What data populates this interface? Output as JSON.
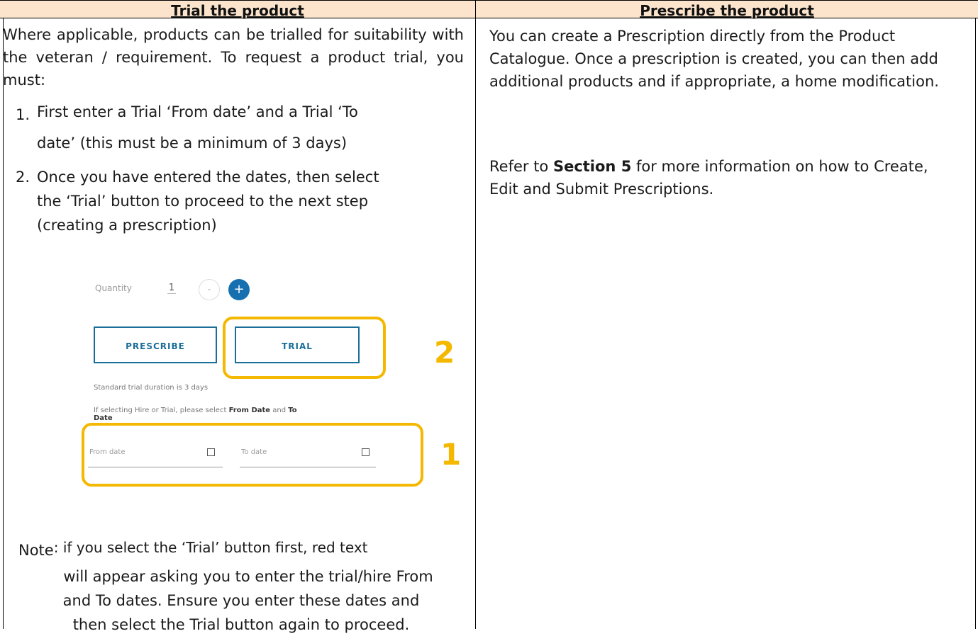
{
  "headers": {
    "left": "Trial the product",
    "right": "Prescribe the product"
  },
  "left": {
    "intro": "Where applicable, products can be trialled for suitability with the veteran / requirement. To request a product trial, you must:",
    "steps": [
      {
        "num": "1.",
        "line1": "First enter a Trial ‘From date’ and a Trial ‘To",
        "line2": "date’  (this must be a minimum of 3 days)"
      },
      {
        "num": "2.",
        "line1": "Once you have entered the dates, then select",
        "line2": "the ‘Trial’ button to proceed to the next step",
        "line3": "(creating a prescription)"
      }
    ],
    "screenshot": {
      "quantity_label": "Quantity",
      "quantity_value": "1",
      "minus": "-",
      "plus": "+",
      "prescribe_button": "PRESCRIBE",
      "trial_button": "TRIAL",
      "duration_text": "Standard trial duration is 3 days",
      "instruction_prefix": "If selecting Hire or Trial, please select ",
      "instruction_from": "From Date",
      "instruction_and": " and ",
      "instruction_to": "To",
      "instruction_to2": "Date",
      "from_placeholder": "From date",
      "to_placeholder": "To date",
      "callout_1": "1",
      "callout_2": "2",
      "highlight_color": "#F5B800",
      "button_color": "#1a6e9a"
    },
    "note_label": "Note",
    "note_line1": ": if you select the ‘Trial’ button first, red text",
    "note_line2": "will appear asking you to enter the trial/hire From",
    "note_line3": "and To dates. Ensure you enter these dates and",
    "note_line4": "then select the Trial button again to proceed."
  },
  "right": {
    "para1": "You can create a Prescription directly from the Product Catalogue. Once a prescription is created, you can then add additional products and if appropriate, a home modification.",
    "para2_prefix": "Refer to ",
    "para2_bold": "Section 5",
    "para2_suffix": " for more information on how to Create, Edit and Submit Prescriptions."
  },
  "colors": {
    "header_bg": "#FBE4CB"
  }
}
